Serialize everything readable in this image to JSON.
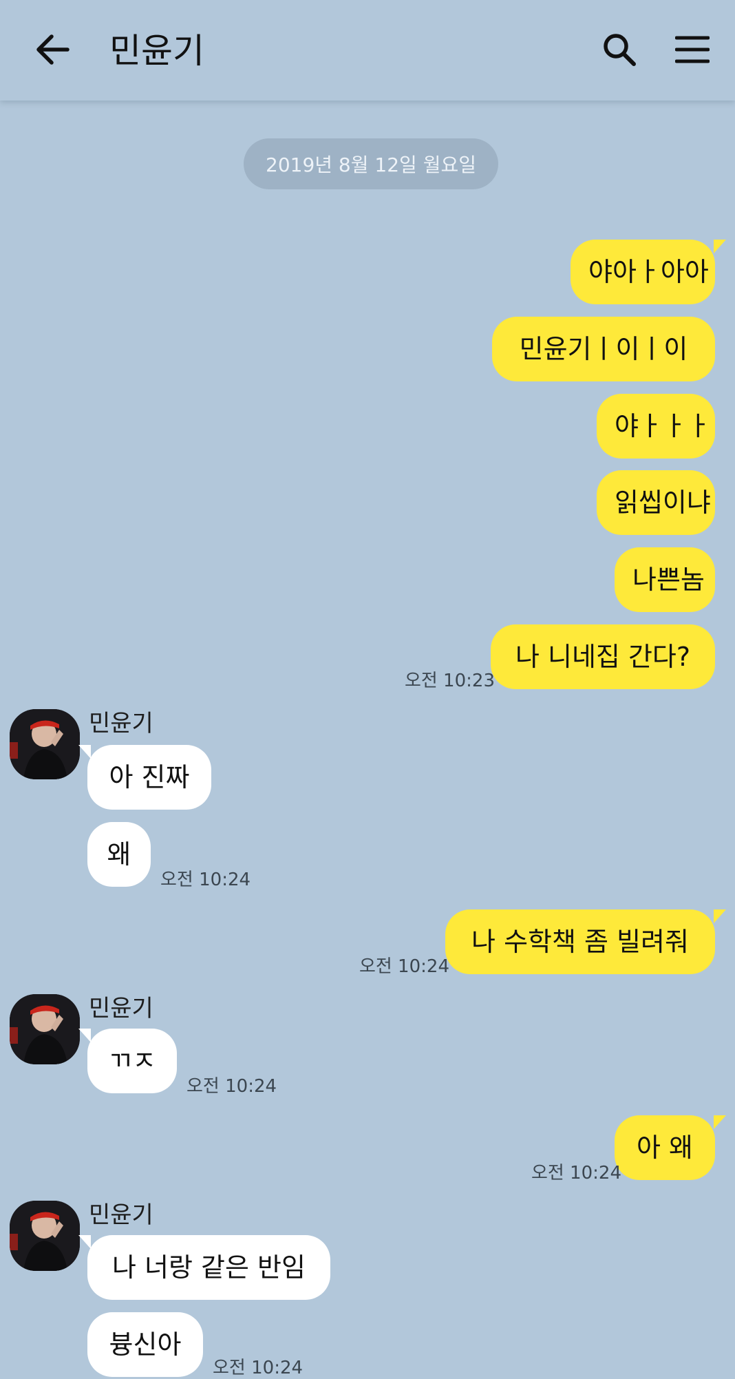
{
  "header": {
    "title": "민윤기",
    "back_icon": "arrow-left-icon",
    "search_icon": "search-icon",
    "menu_icon": "menu-icon"
  },
  "date_divider": "2019년 8월 12일 월요일",
  "colors": {
    "background": "#b2c7da",
    "my_bubble": "#fee93a",
    "their_bubble": "#ffffff"
  },
  "sender_name": "민윤기",
  "messages": [
    {
      "from": "me",
      "text": "야아ㅏ아아"
    },
    {
      "from": "me",
      "text": "민윤기ㅣ이ㅣ이"
    },
    {
      "from": "me",
      "text": "야ㅏㅏㅏ"
    },
    {
      "from": "me",
      "text": "읽씹이냐"
    },
    {
      "from": "me",
      "text": "나쁜놈"
    },
    {
      "from": "me",
      "text": "나 니네집 간다?",
      "time": "오전 10:23"
    },
    {
      "from": "them",
      "text": "아 진짜"
    },
    {
      "from": "them",
      "text": "왜",
      "time": "오전 10:24"
    },
    {
      "from": "me",
      "text": "나 수학책 좀 빌려줘",
      "time": "오전 10:24"
    },
    {
      "from": "them",
      "text": "ㄲㅈ",
      "time": "오전 10:24"
    },
    {
      "from": "me",
      "text": "아 왜",
      "time": "오전 10:24"
    },
    {
      "from": "them",
      "text": "나 너랑 같은 반임"
    },
    {
      "from": "them",
      "text": "븅신아",
      "time": "오전 10:24"
    }
  ]
}
